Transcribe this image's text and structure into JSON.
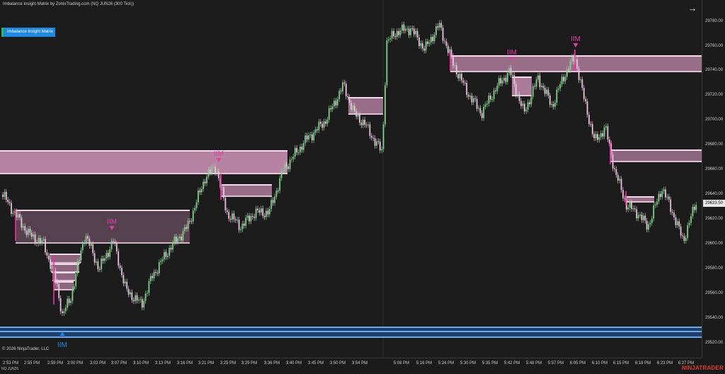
{
  "header": {
    "title": "Imbalance Insight Matrix by ZonixTrading.com (NQ JUN26 (300 Tick))"
  },
  "indicator_button": {
    "label": "Imbalance Insight Matrix"
  },
  "current_price": "29633.50",
  "price_axis": {
    "labels": [
      "29780.00",
      "29760.00",
      "29740.00",
      "29720.00",
      "29700.00",
      "29680.00",
      "29660.00",
      "29640.00",
      "29620.00",
      "29600.00",
      "29580.00",
      "29560.00",
      "29540.00",
      "29520.00"
    ]
  },
  "time_axis": {
    "labels": [
      "2:53 PM",
      "2:55 PM",
      "2:59 PM",
      "3:00 PM",
      "3:03 PM",
      "3:07 PM",
      "3:10 PM",
      "3:13 PM",
      "3:16 PM",
      "3:21 PM",
      "3:25 PM",
      "3:29 PM",
      "3:36 PM",
      "3:40 PM",
      "3:45 PM",
      "3:50 PM",
      "3:54 PM",
      "5:08 PM",
      "5:16 PM",
      "5:24 PM",
      "5:30 PM",
      "5:35 PM",
      "5:42 PM",
      "5:48 PM",
      "5:57 PM",
      "6:05 PM",
      "6:10 PM",
      "6:15 PM",
      "6:18 PM",
      "6:23 PM",
      "6:27 PM"
    ]
  },
  "markers": [
    {
      "label": "IIM",
      "color": "#e23fa0"
    },
    {
      "label": "IIM",
      "color": "#e23fa0"
    },
    {
      "label": "IIM",
      "color": "#e23fa0"
    },
    {
      "label": "IIM",
      "color": "#e23fa0"
    },
    {
      "label": "IIM",
      "color": "#1e88e5"
    }
  ],
  "footer": {
    "copyright": "© 2026 NinjaTrader, LLC",
    "instrument": "NQ JUN26",
    "brand": "NINJATRADER"
  },
  "colors": {
    "up": "#7fd38a",
    "down": "#e9c2dc",
    "zone_pink": "#e9a4cf",
    "zone_blue": "#6ea8e8",
    "accent": "#1e88e5"
  },
  "icons": {
    "jump_arrow": "arrow-right-icon"
  }
}
